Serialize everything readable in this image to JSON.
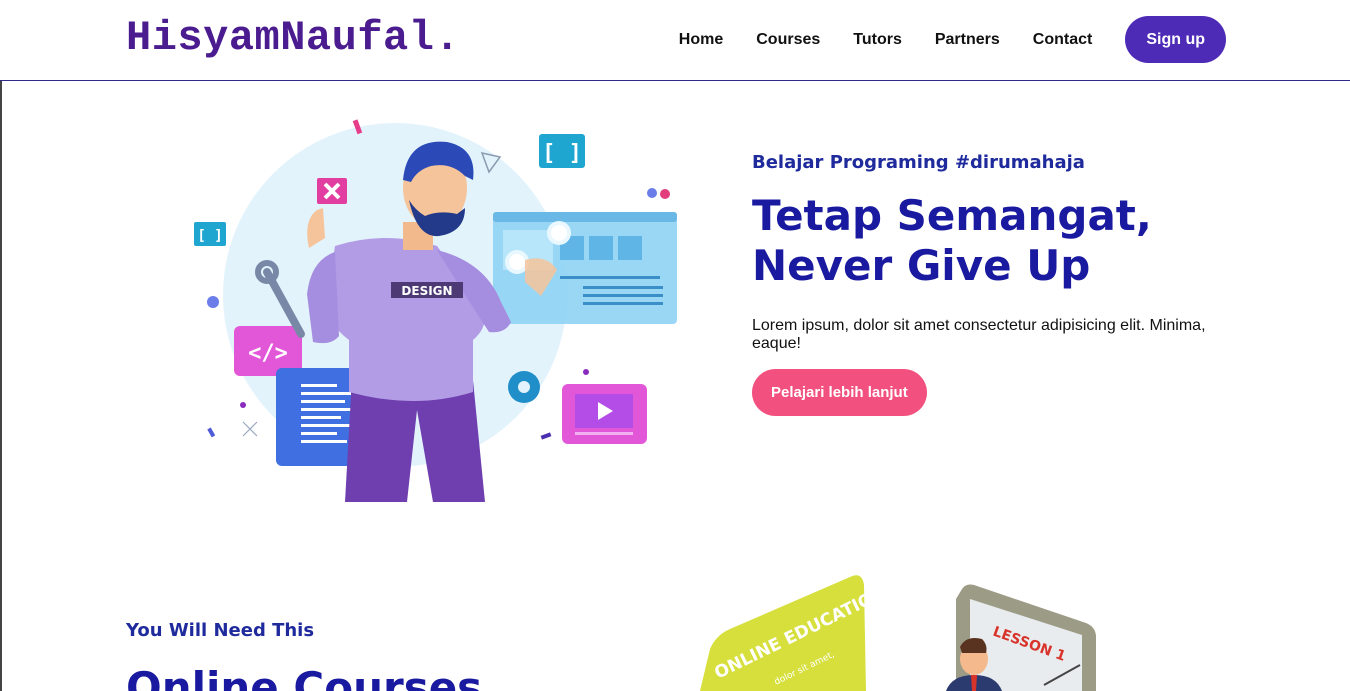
{
  "header": {
    "brand": "HisyamNaufal.",
    "nav": [
      {
        "label": "Home"
      },
      {
        "label": "Courses"
      },
      {
        "label": "Tutors"
      },
      {
        "label": "Partners"
      },
      {
        "label": "Contact"
      }
    ],
    "signup_label": "Sign up"
  },
  "hero": {
    "eyebrow": "Belajar Programing #dirumahaja",
    "title_line1": "Tetap Semangat,",
    "title_line2": "Never Give Up",
    "description": "Lorem ipsum, dolor sit amet consectetur adipisicing elit. Minima, eaque!",
    "cta_label": "Pelajari lebih lanjut",
    "illustration_badge": "DESIGN"
  },
  "section2": {
    "eyebrow": "You Will Need This",
    "title": "Online Courses",
    "card_heading": "ONLINE EDUCATION",
    "card_small": "dolor sit amet,",
    "board_label": "LESSON 1"
  },
  "colors": {
    "brand": "#4b1c8f",
    "accent": "#4e2bb7",
    "cta": "#f2507f",
    "heading": "#1a1aa0"
  }
}
